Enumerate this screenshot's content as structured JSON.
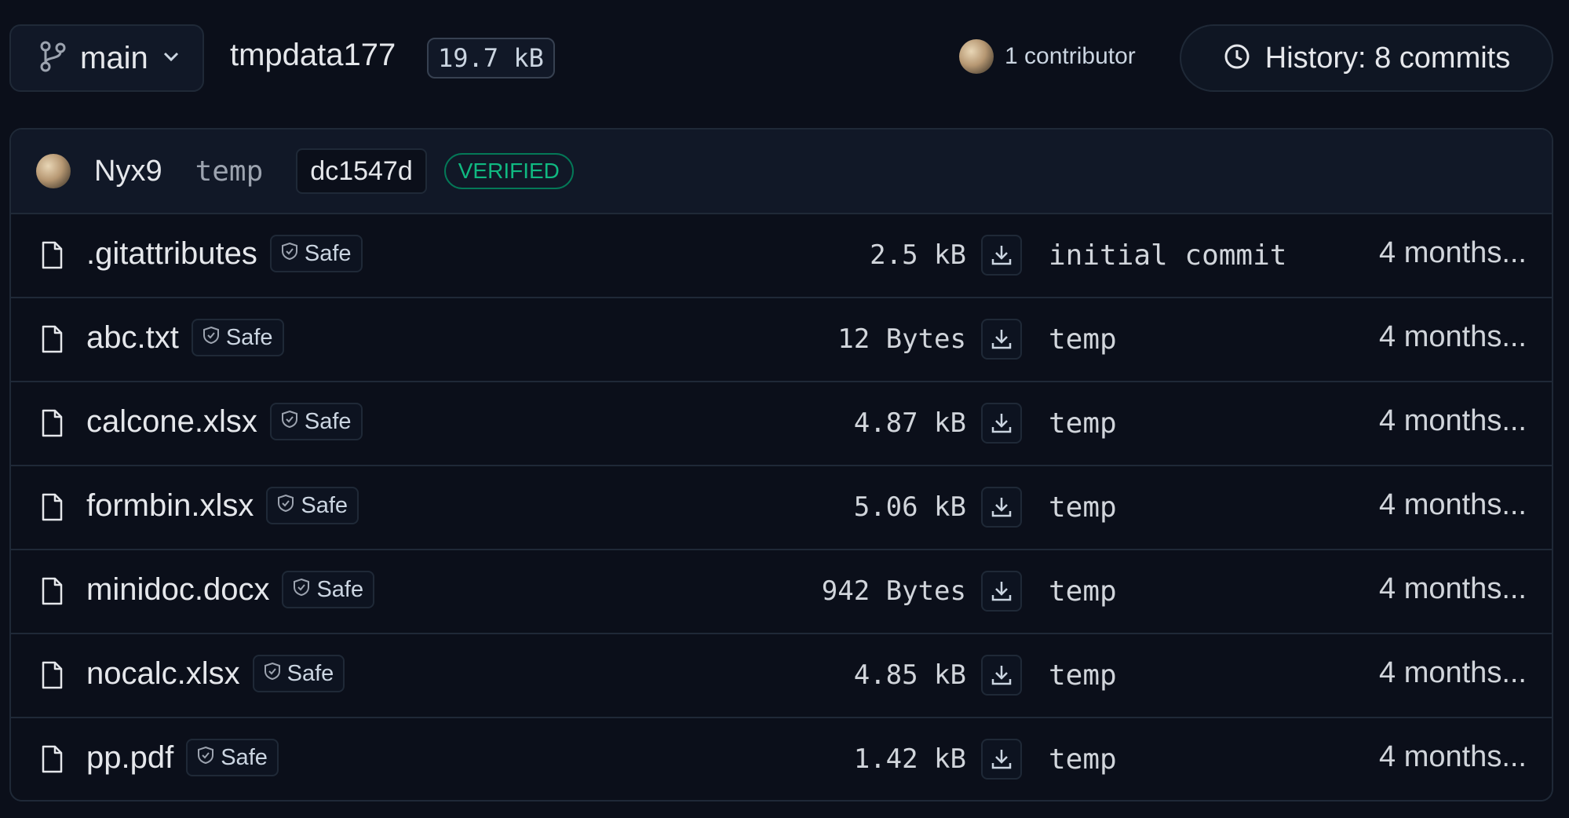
{
  "header": {
    "branch_label": "main",
    "repo_name": "tmpdata177",
    "repo_size": "19.7 kB",
    "contributors_label": "1 contributor",
    "history_label": "History: 8 commits"
  },
  "last_commit": {
    "author": "Nyx9",
    "message": "temp",
    "hash": "dc1547d",
    "verified_label": "VERIFIED"
  },
  "files": [
    {
      "name": ".gitattributes",
      "safe": "Safe",
      "size": "2.5 kB",
      "message": "initial commit",
      "date": "4 months..."
    },
    {
      "name": "abc.txt",
      "safe": "Safe",
      "size": "12 Bytes",
      "message": "temp",
      "date": "4 months..."
    },
    {
      "name": "calcone.xlsx",
      "safe": "Safe",
      "size": "4.87 kB",
      "message": "temp",
      "date": "4 months..."
    },
    {
      "name": "formbin.xlsx",
      "safe": "Safe",
      "size": "5.06 kB",
      "message": "temp",
      "date": "4 months..."
    },
    {
      "name": "minidoc.docx",
      "safe": "Safe",
      "size": "942 Bytes",
      "message": "temp",
      "date": "4 months..."
    },
    {
      "name": "nocalc.xlsx",
      "safe": "Safe",
      "size": "4.85 kB",
      "message": "temp",
      "date": "4 months..."
    },
    {
      "name": "pp.pdf",
      "safe": "Safe",
      "size": "1.42 kB",
      "message": "temp",
      "date": "4 months..."
    }
  ],
  "icons": {
    "branch": "git-branch-icon",
    "chevron": "chevron-down-icon",
    "history": "clock-icon",
    "file": "file-icon",
    "shield": "shield-check-icon",
    "download": "download-icon"
  },
  "colors": {
    "background": "#0b0f1a",
    "panel": "#111827",
    "border": "#1f2937",
    "verified": "#10b981"
  }
}
